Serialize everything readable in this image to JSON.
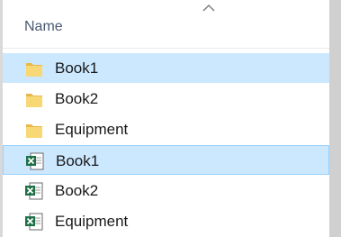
{
  "column_header": {
    "name_label": "Name"
  },
  "items": [
    {
      "label": "Book1",
      "type": "folder",
      "state": "selected"
    },
    {
      "label": "Book2",
      "type": "folder",
      "state": "normal"
    },
    {
      "label": "Equipment",
      "type": "folder",
      "state": "normal"
    },
    {
      "label": "Book1",
      "type": "excel-file",
      "state": "focused"
    },
    {
      "label": "Book2",
      "type": "excel-file",
      "state": "normal"
    },
    {
      "label": "Equipment",
      "type": "excel-file",
      "state": "normal"
    }
  ],
  "colors": {
    "selection": "#cce8ff",
    "focus_border": "#99d1ff",
    "folder": "#f8d775",
    "excel": "#1e7145"
  }
}
